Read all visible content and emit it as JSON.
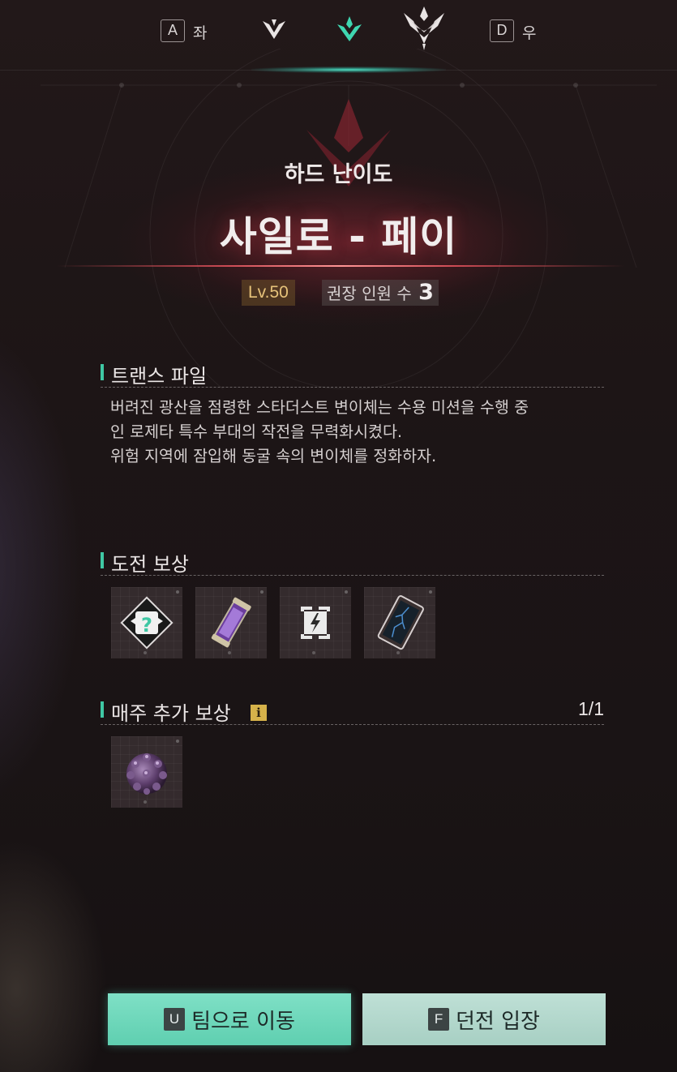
{
  "nav": {
    "left_key": "A",
    "left_label": "좌",
    "right_key": "D",
    "right_label": "우",
    "difficulty_icons": [
      "normal-difficulty-icon",
      "hard-difficulty-icon",
      "nightmare-difficulty-icon"
    ],
    "selected_index": 1
  },
  "header": {
    "difficulty": "하드 난이도",
    "title": "사일로 - 페이",
    "level": "Lv.50",
    "party_label": "권장 인원 수",
    "party_size": "3"
  },
  "trans_file": {
    "heading": "트랜스 파일",
    "lines": [
      "버려진 광산을 점령한 스타더스트 변이체는 수용 미션을 수행 중",
      "인 로제타 특수 부대의 작전을 무력화시켰다.",
      "위험 지역에 잠입해 동굴 속의 변이체를 정화하자."
    ]
  },
  "challenge_rewards": {
    "heading": "도전 보상",
    "items": [
      {
        "icon": "mystery-gear-icon"
      },
      {
        "icon": "energy-capsule-icon"
      },
      {
        "icon": "random-module-icon"
      },
      {
        "icon": "data-card-icon"
      }
    ]
  },
  "weekly_rewards": {
    "heading": "매주 추가 보상",
    "info_icon": "i",
    "count": "1/1",
    "items": [
      {
        "icon": "spiky-ore-icon"
      }
    ]
  },
  "buttons": {
    "team_key": "U",
    "team_label": "팀으로 이동",
    "enter_key": "F",
    "enter_label": "던전 입장"
  },
  "colors": {
    "accent_teal": "#3fc7a4",
    "title_glow": "#dc5060",
    "level_gold": "#e6c27a"
  }
}
